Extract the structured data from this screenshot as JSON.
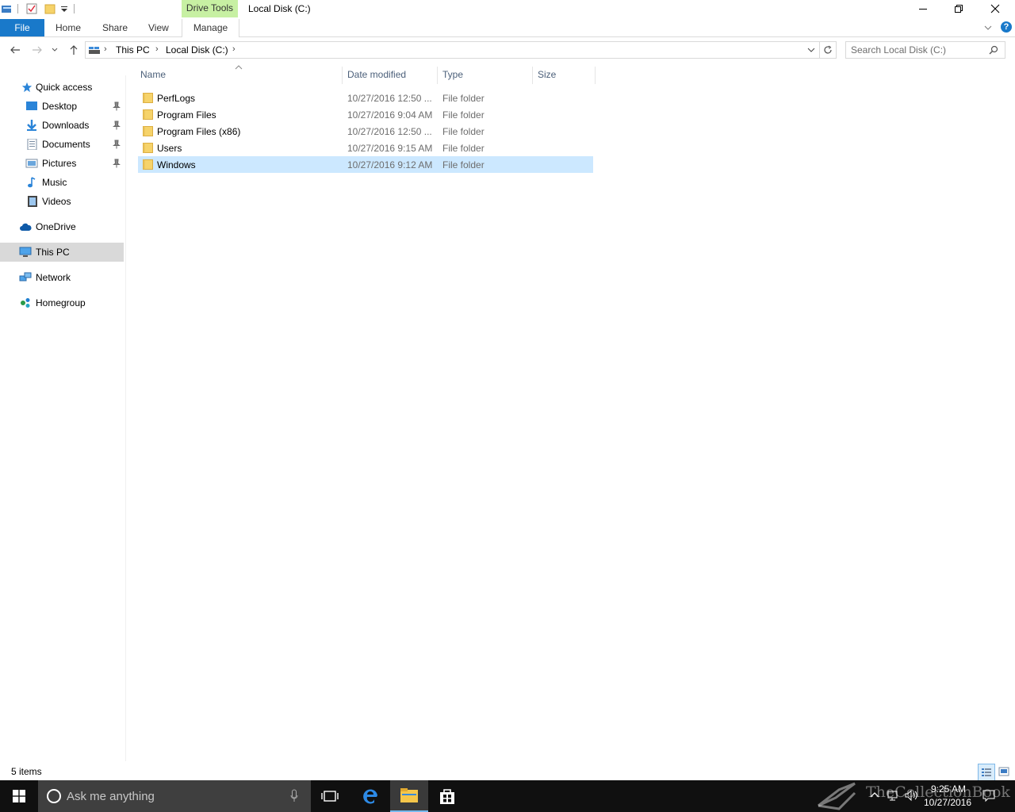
{
  "window": {
    "context_tab": "Drive Tools",
    "title": "Local Disk (C:)"
  },
  "ribbon": {
    "tabs": [
      {
        "label": "File"
      },
      {
        "label": "Home"
      },
      {
        "label": "Share"
      },
      {
        "label": "View"
      },
      {
        "label": "Manage"
      }
    ]
  },
  "address": {
    "crumbs": [
      "This PC",
      "Local Disk (C:)"
    ]
  },
  "search": {
    "placeholder": "Search Local Disk (C:)"
  },
  "navpane": {
    "items": [
      {
        "label": "Quick access"
      },
      {
        "label": "Desktop"
      },
      {
        "label": "Downloads"
      },
      {
        "label": "Documents"
      },
      {
        "label": "Pictures"
      },
      {
        "label": "Music"
      },
      {
        "label": "Videos"
      },
      {
        "label": "OneDrive"
      },
      {
        "label": "This PC"
      },
      {
        "label": "Network"
      },
      {
        "label": "Homegroup"
      }
    ]
  },
  "filelist": {
    "columns": [
      "Name",
      "Date modified",
      "Type",
      "Size"
    ],
    "rows": [
      {
        "name": "PerfLogs",
        "date": "10/27/2016 12:50 ...",
        "type": "File folder"
      },
      {
        "name": "Program Files",
        "date": "10/27/2016 9:04 AM",
        "type": "File folder"
      },
      {
        "name": "Program Files (x86)",
        "date": "10/27/2016 12:50 ...",
        "type": "File folder"
      },
      {
        "name": "Users",
        "date": "10/27/2016 9:15 AM",
        "type": "File folder"
      },
      {
        "name": "Windows",
        "date": "10/27/2016 9:12 AM",
        "type": "File folder"
      }
    ]
  },
  "status": {
    "item_count": "5 items"
  },
  "taskbar": {
    "search_placeholder": "Ask me anything",
    "time": "9:25 AM",
    "date": "10/27/2016",
    "watermark": "TheCollectionBook"
  },
  "colors": {
    "file_tab": "#1979ca",
    "drive_tools": "#c7f0a3",
    "selection": "#cce8ff",
    "folder": "#f6d36a",
    "taskbar": "#101010"
  }
}
